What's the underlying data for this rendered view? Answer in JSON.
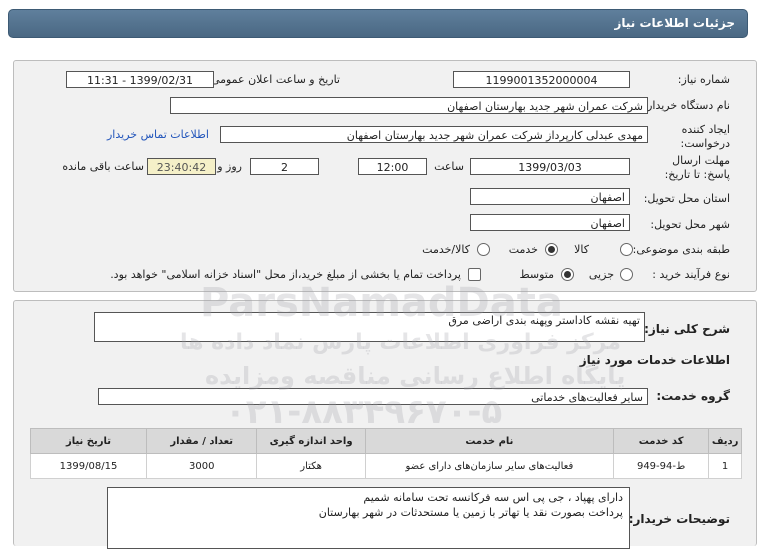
{
  "header": {
    "title": "جزئیات اطلاعات نیاز"
  },
  "form": {
    "need_number_label": "شماره نیاز:",
    "need_number": "1199001352000004",
    "announce_label": "تاریخ و ساعت اعلان عمومی:",
    "announce_value": "1399/02/31 - 11:31",
    "buyer_org_label": "نام دستگاه خریدار:",
    "buyer_org": "شرکت عمران شهر جدید بهارستان اصفهان",
    "creator_label": "ایجاد کننده درخواست:",
    "creator": "مهدی عبدلی کارپرداز شرکت عمران شهر جدید بهارستان اصفهان",
    "contact_link": "اطلاعات تماس خریدار",
    "deadline_label": "مهلت ارسال پاسخ: تا تاریخ:",
    "deadline_date": "1399/03/03",
    "time_label": "ساعت",
    "deadline_time": "12:00",
    "days_value": "2",
    "days_label": "روز و",
    "remaining_time": "23:40:42",
    "remaining_label": "ساعت باقی مانده",
    "province_label": "استان محل تحویل:",
    "province": "اصفهان",
    "city_label": "شهر محل تحویل:",
    "city": "اصفهان",
    "category_label": "طبقه بندی موضوعی:",
    "category_options": [
      "کالا",
      "خدمت",
      "کالا/خدمت"
    ],
    "category_selected": "خدمت",
    "process_label": "نوع فرآیند خرید :",
    "process_options": [
      "جزیی",
      "متوسط"
    ],
    "process_selected": "متوسط",
    "payment_note": "پرداخت تمام یا بخشی از مبلغ خرید،از محل \"اسناد خزانه اسلامی\" خواهد بود."
  },
  "details": {
    "summary_label": "شرح کلی نیاز:",
    "summary": "تهیه نقشه کاداستر وپهنه بندی اراضی مرق",
    "services_heading": "اطلاعات خدمات مورد نیاز",
    "service_group_label": "گروه خدمت:",
    "service_group": "سایر فعالیت‌های خدماتی",
    "table": {
      "headers": [
        "ردیف",
        "کد خدمت",
        "نام خدمت",
        "واحد اندازه گیری",
        "تعداد / مقدار",
        "تاریخ نیاز"
      ],
      "rows": [
        [
          "1",
          "ط-94-949",
          "فعالیت‌های سایر سازمان‌های دارای عضو",
          "هکتار",
          "3000",
          "1399/08/15"
        ]
      ]
    },
    "buyer_notes_label": "توضیحات خریدار:",
    "buyer_notes": [
      "دارای پهپاد ، جی پی اس سه فرکانسه تحت سامانه شمیم",
      "پرداخت بصورت نقد یا تهاتر با زمین یا مستحدثات در شهر بهارستان"
    ]
  },
  "watermark": {
    "line1": "ParsNamadData",
    "line2": "مرکز فراوری اطلاعات پارس نماد داده ها",
    "line3": "پایگاه اطلاع رسانی مناقصه ومزایده",
    "line4": "۰۲۱-۸۸۳۴۹۶۷۰-۵"
  }
}
